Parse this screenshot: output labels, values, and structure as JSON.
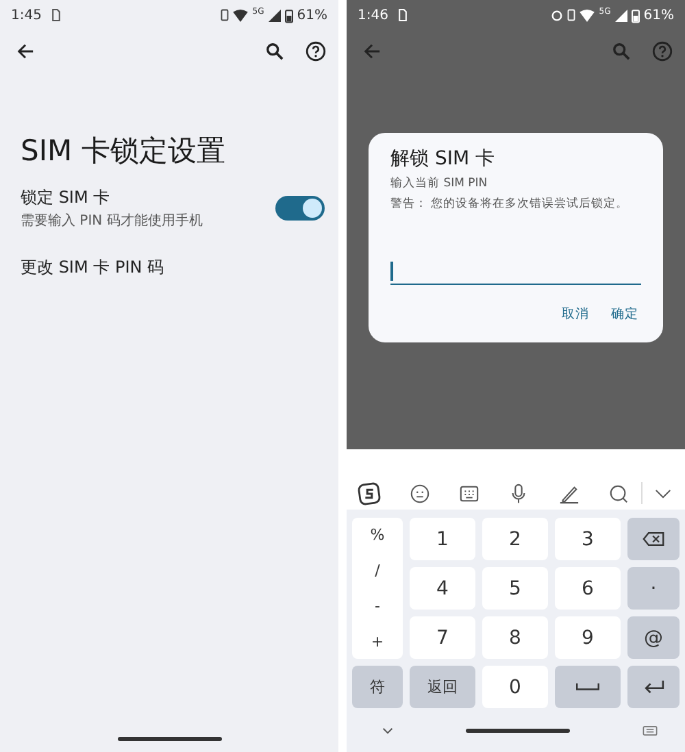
{
  "left_screen": {
    "status_bar": {
      "time": "1:45",
      "network": "5G",
      "battery": "61%"
    },
    "title": "SIM 卡锁定设置",
    "settings": [
      {
        "kind": "toggle",
        "title": "锁定 SIM 卡",
        "subtitle": "需要输入 PIN 码才能使用手机",
        "on": true
      },
      {
        "kind": "link",
        "title": "更改 SIM 卡 PIN 码"
      }
    ]
  },
  "right_screen": {
    "status_bar": {
      "time": "1:46",
      "network": "5G",
      "battery": "61%"
    },
    "dialog": {
      "title": "解锁 SIM 卡",
      "message": "输入当前 SIM PIN",
      "warning": "警告： 您的设备将在多次错误尝试后锁定。",
      "buttons": [
        "取消",
        "确定"
      ]
    },
    "keyboard": {
      "symbols": [
        "%",
        "/",
        "-",
        "+"
      ],
      "rows": [
        [
          {
            "kind": "char",
            "label": "1"
          },
          {
            "kind": "char",
            "label": "2"
          },
          {
            "kind": "char",
            "label": "3"
          },
          {
            "kind": "backspace"
          }
        ],
        [
          {
            "kind": "char",
            "label": "4"
          },
          {
            "kind": "char",
            "label": "5"
          },
          {
            "kind": "char",
            "label": "6"
          },
          {
            "kind": "func",
            "label": "·"
          }
        ],
        [
          {
            "kind": "char",
            "label": "7"
          },
          {
            "kind": "char",
            "label": "8"
          },
          {
            "kind": "char",
            "label": "9"
          },
          {
            "kind": "func",
            "label": "@"
          }
        ]
      ],
      "bottom_keys": [
        {
          "kind": "func",
          "label": "符"
        },
        {
          "kind": "func",
          "label": "返回"
        },
        {
          "kind": "char",
          "label": "0"
        },
        {
          "kind": "space"
        },
        {
          "kind": "enter"
        }
      ]
    }
  }
}
